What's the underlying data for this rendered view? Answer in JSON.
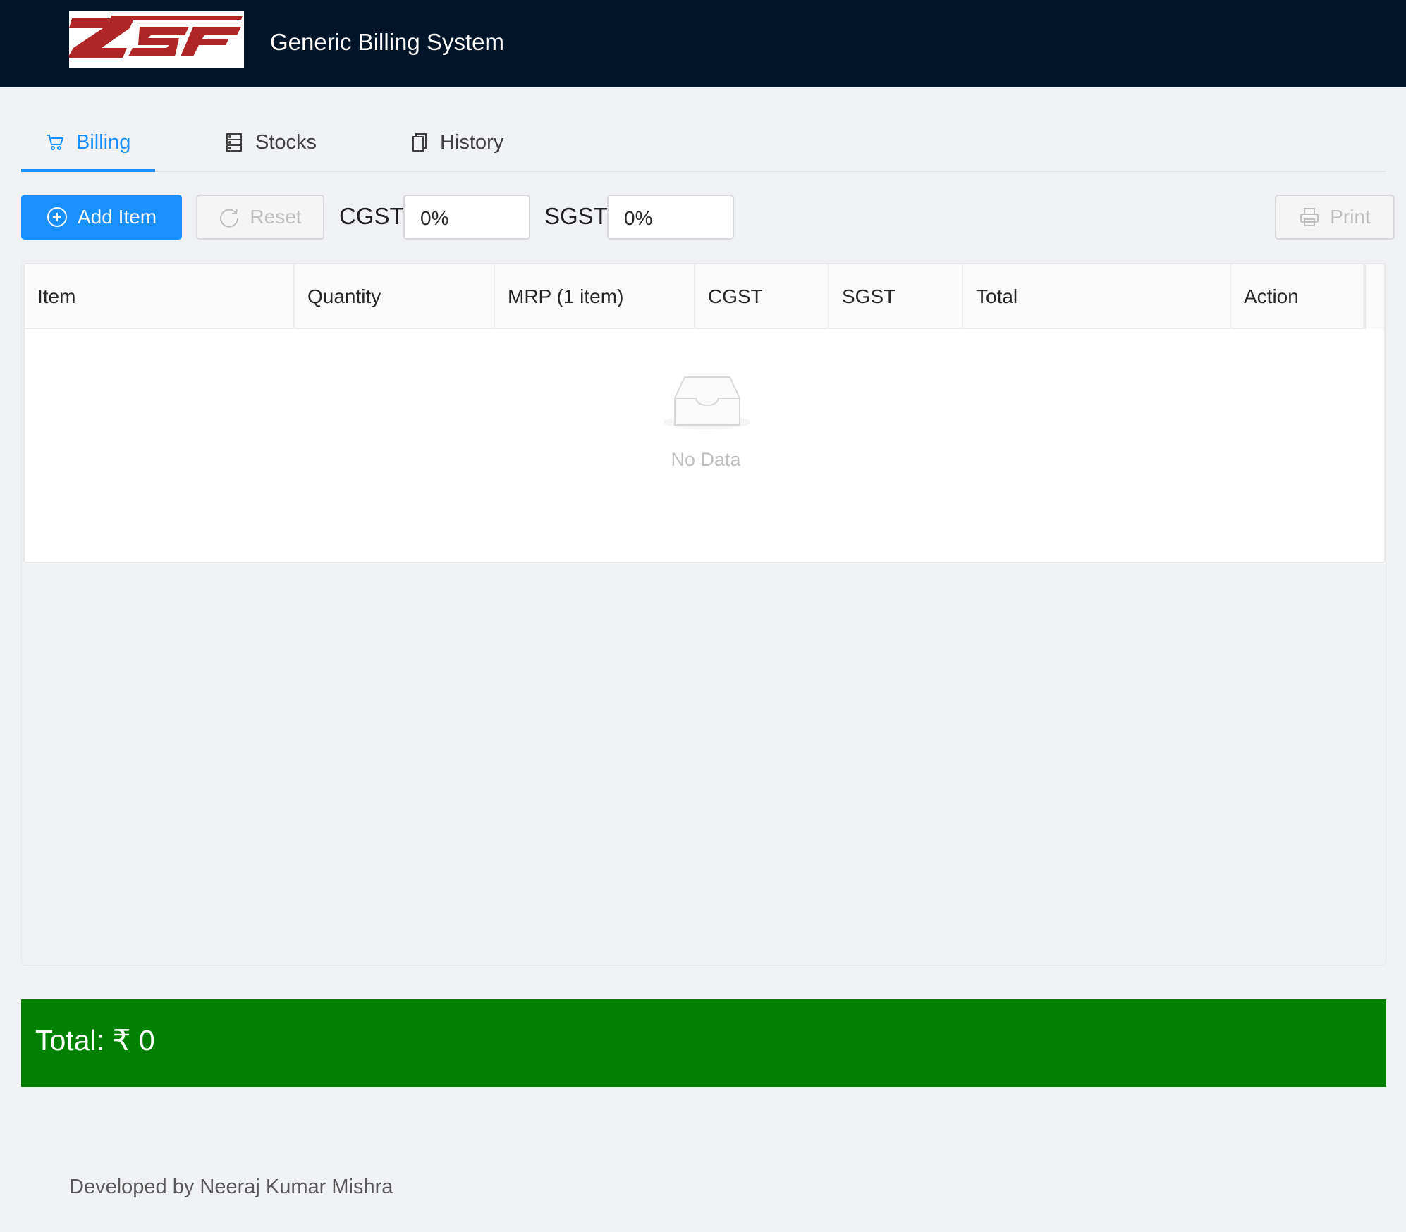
{
  "header": {
    "logo_text": "ZSF",
    "app_title": "Generic Billing System"
  },
  "tabs": [
    {
      "label": "Billing",
      "icon": "cart-icon",
      "active": true
    },
    {
      "label": "Stocks",
      "icon": "database-icon",
      "active": false
    },
    {
      "label": "History",
      "icon": "copy-icon",
      "active": false
    }
  ],
  "toolbar": {
    "add_label": "Add Item",
    "reset_label": "Reset",
    "cgst_label": "CGST",
    "cgst_value": "0%",
    "sgst_label": "SGST",
    "sgst_value": "0%",
    "print_label": "Print"
  },
  "table": {
    "columns": [
      "Item",
      "Quantity",
      "MRP (1 item)",
      "CGST",
      "SGST",
      "Total",
      "Action"
    ],
    "rows": [],
    "empty_text": "No Data"
  },
  "total": {
    "text": "Total: ₹ 0"
  },
  "footer": {
    "text": "Developed by Neeraj Kumar Mishra"
  },
  "colors": {
    "header_bg": "#001529",
    "primary": "#1890ff",
    "total_bg": "#008000",
    "logo_red": "#b02626"
  }
}
